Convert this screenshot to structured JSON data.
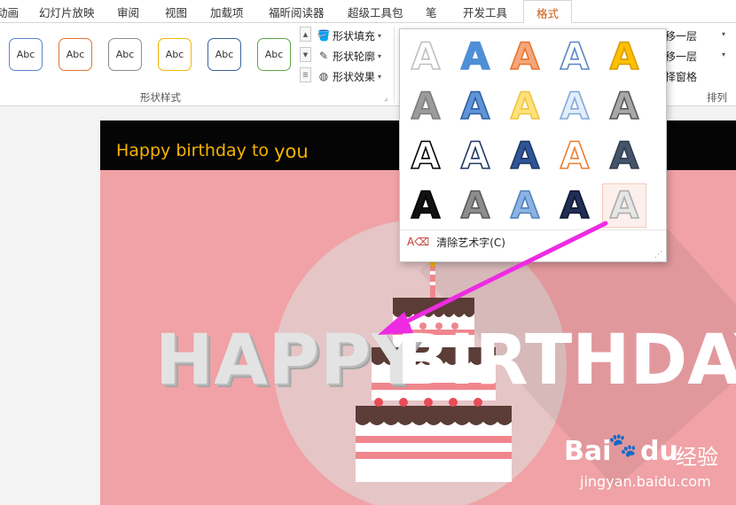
{
  "ribbon": {
    "tabs": [
      {
        "label": "动画"
      },
      {
        "label": "幻灯片放映"
      },
      {
        "label": "审阅"
      },
      {
        "label": "视图"
      },
      {
        "label": "加载项"
      },
      {
        "label": "福昕阅读器"
      },
      {
        "label": "超级工具包"
      },
      {
        "label": "笔"
      },
      {
        "label": "开发工具"
      },
      {
        "label": "格式",
        "active": true
      }
    ],
    "shape_styles": {
      "presets": [
        {
          "label": "Abc",
          "border": "#5a86c6"
        },
        {
          "label": "Abc",
          "border": "#e07432"
        },
        {
          "label": "Abc",
          "border": "#8c8c8c"
        },
        {
          "label": "Abc",
          "border": "#f2b500"
        },
        {
          "label": "Abc",
          "border": "#3c63a3"
        },
        {
          "label": "Abc",
          "border": "#5fa64a"
        }
      ],
      "group_label": "形状样式",
      "fill_label": "形状填充",
      "outline_label": "形状轮廓",
      "effects_label": "形状效果"
    },
    "arrange": {
      "bring_forward_label": "上移一层",
      "send_backward_label": "下移一层",
      "selection_pane_label": "选择窗格",
      "group_label": "排列"
    }
  },
  "wordart_gallery": {
    "selected_index": 19,
    "clear_label": "清除艺术字(C)",
    "styles": [
      {
        "letter": "A",
        "icon": "wordart-outline-light-icon",
        "fill": "#ffffff",
        "stroke": "#bfbfbf"
      },
      {
        "letter": "A",
        "icon": "wordart-blue-fill-icon",
        "fill": "#4f8fd6",
        "stroke": "#4f8fd6"
      },
      {
        "letter": "A",
        "icon": "wordart-orange-outline-icon",
        "fill": "#f4a77d",
        "stroke": "#e8742a"
      },
      {
        "letter": "A",
        "icon": "wordart-blue-outline-icon",
        "fill": "#ffffff",
        "stroke": "#5a86c6"
      },
      {
        "letter": "A",
        "icon": "wordart-gold-fill-icon",
        "fill": "#ffc000",
        "stroke": "#d99a00"
      },
      {
        "letter": "A",
        "icon": "wordart-gray-fill-icon",
        "fill": "#9b9b9b",
        "stroke": "#7d7d7d"
      },
      {
        "letter": "A",
        "icon": "wordart-blue-reflection-icon",
        "fill": "#5f95d8",
        "stroke": "#2e5fa3"
      },
      {
        "letter": "A",
        "icon": "wordart-yellow-fill-icon",
        "fill": "#ffe27a",
        "stroke": "#f0c340"
      },
      {
        "letter": "A",
        "icon": "wordart-light-blue-outline-icon",
        "fill": "#e3eefa",
        "stroke": "#7fa9dc"
      },
      {
        "letter": "A",
        "icon": "wordart-gray-shadow-icon",
        "fill": "#a8a8a8",
        "stroke": "#595959"
      },
      {
        "letter": "A",
        "icon": "wordart-black-outline-icon",
        "fill": "#ffffff",
        "stroke": "#000000"
      },
      {
        "letter": "A",
        "icon": "wordart-navy-outline-icon",
        "fill": "#ffffff",
        "stroke": "#1f3864"
      },
      {
        "letter": "A",
        "icon": "wordart-dark-blue-fill-icon",
        "fill": "#2f5597",
        "stroke": "#1f3864"
      },
      {
        "letter": "A",
        "icon": "wordart-orange-thin-icon",
        "fill": "#ffffff",
        "stroke": "#ed7d31"
      },
      {
        "letter": "A",
        "icon": "wordart-slate-fill-icon",
        "fill": "#44546a",
        "stroke": "#333f50"
      },
      {
        "letter": "A",
        "icon": "wordart-black-stripe-icon",
        "fill": "#111111",
        "stroke": "#000000"
      },
      {
        "letter": "A",
        "icon": "wordart-gray-stripe-icon",
        "fill": "#8d8d8d",
        "stroke": "#5a5a5a"
      },
      {
        "letter": "A",
        "icon": "wordart-blue-stripe-icon",
        "fill": "#8db3e2",
        "stroke": "#4f81bd"
      },
      {
        "letter": "A",
        "icon": "wordart-navy-stripe-icon",
        "fill": "#1f2e54",
        "stroke": "#0d1630"
      },
      {
        "letter": "A",
        "icon": "wordart-white-pattern-icon",
        "fill": "#e6e6e6",
        "stroke": "#aaaaaa"
      }
    ]
  },
  "slide": {
    "greeting_text": "Happy birthday to",
    "greeting_you": "you",
    "happy_text": "HAPPY",
    "birthday_text": "BIRTHDAY",
    "background_color": "#f0a2a6",
    "accent_color": "#f6b400"
  },
  "annotation": {
    "arrow_color": "#ee2be3"
  },
  "watermark": {
    "brand_latin": "Bai",
    "brand_latin2": "du",
    "brand_cn": "经验",
    "url": "jingyan.baidu.com"
  }
}
